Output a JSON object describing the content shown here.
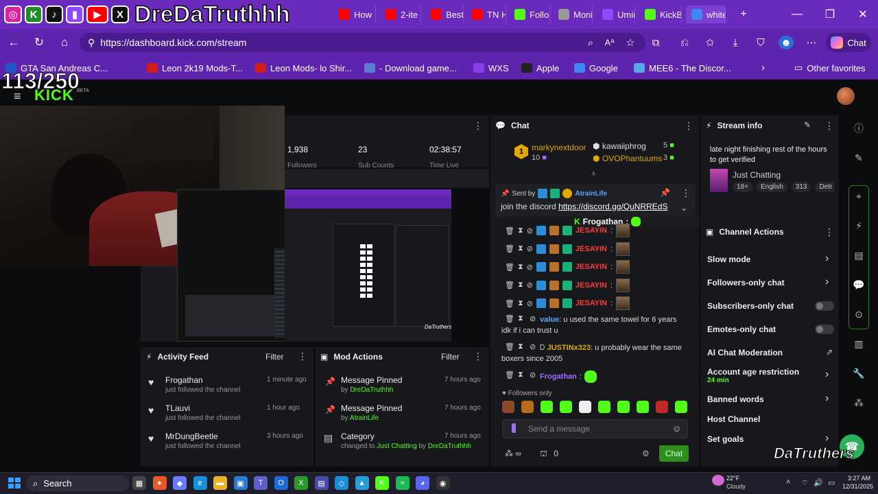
{
  "overlay": {
    "handle": "DreDaTruthhh",
    "counter": "113/250",
    "watermark": "DaTruthers"
  },
  "browser": {
    "tabs": [
      {
        "label": "How",
        "icon": "youtube-icon",
        "color": "#ff0000"
      },
      {
        "label": "2-ite",
        "icon": "youtube-icon",
        "color": "#ff0000"
      },
      {
        "label": "Best",
        "icon": "youtube-icon",
        "color": "#ff0000"
      },
      {
        "label": "TN H",
        "icon": "youtube-icon",
        "color": "#ff0000"
      },
      {
        "label": "Follo",
        "icon": "kick-icon",
        "color": "#53fc18"
      },
      {
        "label": "Moni",
        "icon": "app-icon",
        "color": "#999999"
      },
      {
        "label": "Umin",
        "icon": "twitch-icon",
        "color": "#9146ff"
      },
      {
        "label": "KickB",
        "icon": "kick-icon",
        "color": "#53fc18"
      },
      {
        "label": "white",
        "icon": "google-icon",
        "color": "#4285f4"
      }
    ],
    "url": "https://dashboard.kick.com/stream",
    "copilot_label": "Chat",
    "favorites": [
      {
        "label": "GTA San Andreas C...",
        "color": "#2456c8"
      },
      {
        "label": "Leon 2k19 Mods-T...",
        "color": "#d01c1c"
      },
      {
        "label": "Leon Mods- lo Shir...",
        "color": "#d01c1c"
      },
      {
        "label": "- Download game...",
        "color": "#5c7ccf"
      },
      {
        "label": "WXS",
        "color": "#8b3ee8"
      },
      {
        "label": "Apple",
        "color": "#222222"
      },
      {
        "label": "Google",
        "color": "#4285f4"
      },
      {
        "label": "MEE6 - The Discor...",
        "color": "#5aa7e8"
      }
    ],
    "other_favorites": "Other favorites"
  },
  "stats": [
    {
      "value": "1,938",
      "label": "Followers"
    },
    {
      "value": "23",
      "label": "Sub Counts"
    },
    {
      "value": "02:38:57",
      "label": "Time Live"
    }
  ],
  "activity_feed": {
    "title": "Activity Feed",
    "filter": "Filter",
    "items": [
      {
        "name": "Frogathan",
        "sub": "just followed the channel",
        "time": "1 minute ago"
      },
      {
        "name": "TLauvi",
        "sub": "just followed the channel",
        "time": "1 hour ago"
      },
      {
        "name": "MrDungBeetle",
        "sub": "just followed the channel",
        "time": "3 hours ago"
      }
    ]
  },
  "mod_actions": {
    "title": "Mod Actions",
    "filter": "Filter",
    "items": [
      {
        "title": "Message Pinned",
        "by": "by",
        "user": "DreDaTruthhh",
        "time": "7 hours ago"
      },
      {
        "title": "Message Pinned",
        "by": "by",
        "user": "AtrainLife",
        "time": "7 hours ago"
      },
      {
        "title": "Category",
        "changed": "changed to",
        "category": "Just Chatting",
        "by": "by",
        "user": "DreDaTruthhh",
        "time": "7 hours ago"
      }
    ]
  },
  "chat": {
    "title": "Chat",
    "leaders": [
      {
        "name": "markynextdoor",
        "count": "10"
      },
      {
        "name": "kawaiiphrog",
        "count": "5"
      },
      {
        "name": "OVOPhantuums",
        "count": "3"
      }
    ],
    "pinned": {
      "sent_by": "Sent by",
      "user": "AtrainLife",
      "text": "join the discord",
      "link": "https://discord.gg/QuNRREdS"
    },
    "highlight": {
      "user": "Frogathan",
      "sep": ":"
    },
    "messages": [
      {
        "user": "JESAYIN",
        "color": "#ff3b3b"
      },
      {
        "user": "JESAYIN",
        "color": "#ff3b3b"
      },
      {
        "user": "JESAYIN",
        "color": "#ff3b3b"
      },
      {
        "user": "JESAYIN",
        "color": "#ff3b3b"
      },
      {
        "user": "JESAYIN",
        "color": "#ff3b3b"
      }
    ],
    "msg_value": {
      "user": "value",
      "text": "u used the same towel for 6 years idk if i can trust u"
    },
    "msg_justin": {
      "user": "JUSTINx323",
      "text": "u probably wear the same boxers since 2005"
    },
    "msg_frog": {
      "user": "Frogathan"
    },
    "followers_only": "Followers only",
    "input_placeholder": "Send a message",
    "viewer_count": "0",
    "send_label": "Chat"
  },
  "stream_info": {
    "title": "Stream info",
    "stream_title": "late night finishing rest of the hours to get verified",
    "category": "Just Chatting",
    "tags": [
      "18+",
      "English",
      "313",
      "Detr"
    ]
  },
  "channel_actions": {
    "title": "Channel Actions",
    "items": [
      {
        "label": "Slow mode"
      },
      {
        "label": "Followers-only chat"
      },
      {
        "label": "Subscribers-only chat"
      },
      {
        "label": "Emotes-only chat"
      },
      {
        "label": "AI Chat Moderation"
      },
      {
        "label": "Account age restriction",
        "sub": "24 min"
      },
      {
        "label": "Banned words"
      },
      {
        "label": "Host Channel"
      },
      {
        "label": "Set goals"
      }
    ]
  },
  "taskbar": {
    "search": "Search",
    "weather_temp": "22°F",
    "weather_desc": "Cloudy",
    "time": "3:27 AM",
    "date": "12/31/2025"
  }
}
